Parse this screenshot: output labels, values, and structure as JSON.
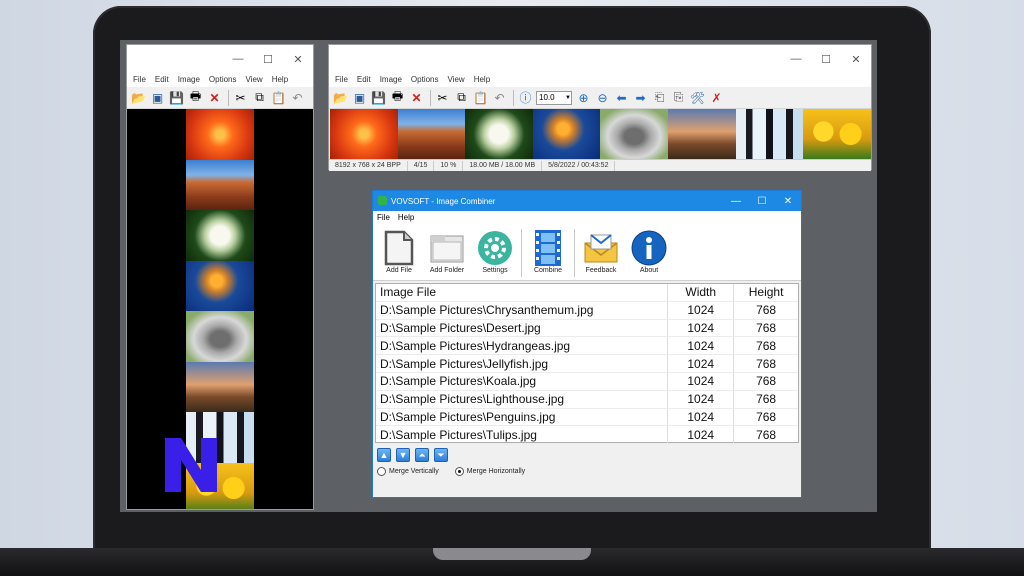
{
  "left_window": {
    "menu": [
      "File",
      "Edit",
      "Image",
      "Options",
      "View",
      "Help"
    ],
    "caption": {
      "minimize": "—",
      "maximize": "☐",
      "close": "✕"
    },
    "thumbnails": [
      "chrysanthemum",
      "desert",
      "hydrangeas",
      "jellyfish",
      "koala",
      "lighthouse",
      "penguins",
      "tulips"
    ]
  },
  "top_window": {
    "menu": [
      "File",
      "Edit",
      "Image",
      "Options",
      "View",
      "Help"
    ],
    "caption": {
      "minimize": "—",
      "maximize": "☐",
      "close": "✕"
    },
    "zoom_value": "10.0",
    "thumbnails": [
      "chrysanthemum",
      "desert",
      "hydrangeas",
      "jellyfish",
      "koala",
      "lighthouse",
      "penguins",
      "tulips"
    ],
    "status": {
      "dimensions": "8192 x 768 x 24 BPP",
      "index": "4/15",
      "zoom": "10 %",
      "memory": "18.00 MB / 18.00 MB",
      "date": "5/8/2022 / 00:43:52"
    }
  },
  "combiner": {
    "title": "VOVSOFT - Image Combiner",
    "caption": {
      "minimize": "—",
      "maximize": "☐",
      "close": "✕"
    },
    "menu": [
      "File",
      "Help"
    ],
    "buttons": {
      "add_file": "Add File",
      "add_folder": "Add Folder",
      "settings": "Settings",
      "combine": "Combine",
      "feedback": "Feedback",
      "about": "About"
    },
    "columns": {
      "file": "Image File",
      "width": "Width",
      "height": "Height"
    },
    "rows": [
      {
        "file": "D:\\Sample Pictures\\Chrysanthemum.jpg",
        "width": "1024",
        "height": "768"
      },
      {
        "file": "D:\\Sample Pictures\\Desert.jpg",
        "width": "1024",
        "height": "768"
      },
      {
        "file": "D:\\Sample Pictures\\Hydrangeas.jpg",
        "width": "1024",
        "height": "768"
      },
      {
        "file": "D:\\Sample Pictures\\Jellyfish.jpg",
        "width": "1024",
        "height": "768"
      },
      {
        "file": "D:\\Sample Pictures\\Koala.jpg",
        "width": "1024",
        "height": "768"
      },
      {
        "file": "D:\\Sample Pictures\\Lighthouse.jpg",
        "width": "1024",
        "height": "768"
      },
      {
        "file": "D:\\Sample Pictures\\Penguins.jpg",
        "width": "1024",
        "height": "768"
      },
      {
        "file": "D:\\Sample Pictures\\Tulips.jpg",
        "width": "1024",
        "height": "768"
      }
    ],
    "merge_options": {
      "vertical": "Merge Vertically",
      "horizontal": "Merge Horizontally",
      "selected": "horizontal"
    }
  },
  "colors": {
    "titlebar_blue": "#1e88e5",
    "overlay_logo": "#3a1fe8"
  }
}
